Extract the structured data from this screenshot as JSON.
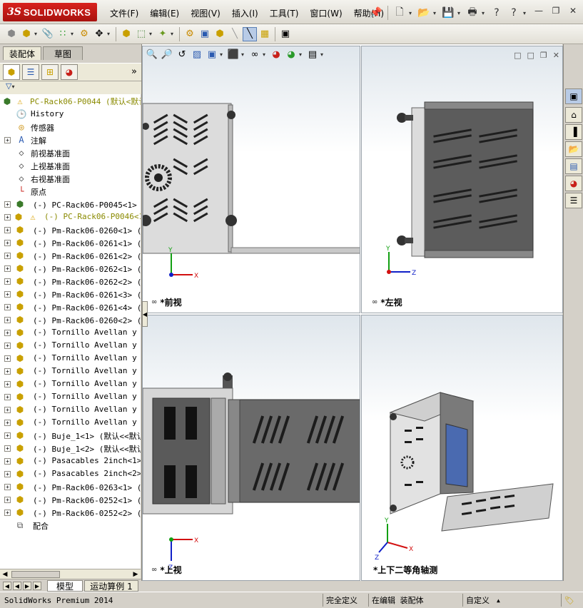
{
  "app": {
    "logo_ds": "3S",
    "logo_name": "SOLIDWORKS"
  },
  "menus": [
    "文件(F)",
    "编辑(E)",
    "视图(V)",
    "插入(I)",
    "工具(T)",
    "窗口(W)",
    "帮助(H)"
  ],
  "left_tabs": {
    "assembly": "装配体",
    "sketch": "草图"
  },
  "tree": {
    "root": "PC-Rack06-P0044 (默认<默认",
    "items": [
      {
        "label": "History",
        "icon": "history-icon",
        "expander": false
      },
      {
        "label": "传感器",
        "icon": "sensor-icon",
        "expander": false
      },
      {
        "label": "注解",
        "icon": "annotation-icon",
        "expander": true
      },
      {
        "label": "前视基准面",
        "icon": "plane-icon",
        "expander": false
      },
      {
        "label": "上视基准面",
        "icon": "plane-icon",
        "expander": false
      },
      {
        "label": "右视基准面",
        "icon": "plane-icon",
        "expander": false
      },
      {
        "label": "原点",
        "icon": "origin-icon",
        "expander": false
      },
      {
        "label": "(-) PC-Rack06-P0045<1> (默",
        "icon": "assembly-icon",
        "expander": true
      },
      {
        "label": "(-) PC-Rack06-P0046<1> (",
        "icon": "warning-icon",
        "expander": true,
        "suppressed": true
      },
      {
        "label": "(-) Pm-Rack06-0260<1> (默",
        "icon": "part-icon",
        "expander": true
      },
      {
        "label": "(-) Pm-Rack06-0261<1> (默",
        "icon": "part-icon",
        "expander": true
      },
      {
        "label": "(-) Pm-Rack06-0261<2> (默",
        "icon": "part-icon",
        "expander": true
      },
      {
        "label": "(-) Pm-Rack06-0262<1> (默",
        "icon": "part-icon",
        "expander": true
      },
      {
        "label": "(-) Pm-Rack06-0262<2> (默",
        "icon": "part-icon",
        "expander": true
      },
      {
        "label": "(-) Pm-Rack06-0261<3> (默",
        "icon": "part-icon",
        "expander": true
      },
      {
        "label": "(-) Pm-Rack06-0261<4> (默",
        "icon": "part-icon",
        "expander": true
      },
      {
        "label": "(-) Pm-Rack06-0260<2> (默",
        "icon": "part-icon",
        "expander": true
      },
      {
        "label": "(-) Tornillo Avellan y Tu",
        "icon": "part-icon",
        "expander": true
      },
      {
        "label": "(-) Tornillo Avellan y Tu",
        "icon": "part-icon",
        "expander": true
      },
      {
        "label": "(-) Tornillo Avellan y Tu",
        "icon": "part-icon",
        "expander": true
      },
      {
        "label": "(-) Tornillo Avellan y Tu",
        "icon": "part-icon",
        "expander": true
      },
      {
        "label": "(-) Tornillo Avellan y Tu",
        "icon": "part-icon",
        "expander": true
      },
      {
        "label": "(-) Tornillo Avellan y Tu",
        "icon": "part-icon",
        "expander": true
      },
      {
        "label": "(-) Tornillo Avellan y Tu",
        "icon": "part-icon",
        "expander": true
      },
      {
        "label": "(-) Tornillo Avellan y Tu",
        "icon": "part-icon",
        "expander": true
      },
      {
        "label": "(-) Buje_1<1> (默认<<默认>",
        "icon": "part-icon",
        "expander": true
      },
      {
        "label": "(-) Buje_1<2> (默认<<默认>",
        "icon": "part-icon",
        "expander": true
      },
      {
        "label": "(-) Pasacables 2inch<1> (",
        "icon": "part-icon",
        "expander": true
      },
      {
        "label": "(-) Pasacables 2inch<2> (",
        "icon": "part-icon",
        "expander": true
      },
      {
        "label": "(-) Pm-Rack06-0263<1> (默",
        "icon": "part-icon",
        "expander": true
      },
      {
        "label": "(-) Pm-Rack06-0252<1> (默",
        "icon": "part-icon",
        "expander": true
      },
      {
        "label": "(-) Pm-Rack06-0252<2> (默",
        "icon": "part-icon",
        "expander": true
      },
      {
        "label": "配合",
        "icon": "mates-icon",
        "expander": false
      }
    ]
  },
  "bottom_tabs": {
    "model": "模型",
    "motion": "运动算例 1"
  },
  "views": {
    "front": "*前视",
    "left": "*左视",
    "top": "*上视",
    "iso": "*上下二等角轴测"
  },
  "axes": {
    "x": "X",
    "y": "Y",
    "z": "Z"
  },
  "status": {
    "product": "SolidWorks Premium 2014",
    "defined": "完全定义",
    "editing": "在编辑 装配体",
    "custom": "自定义"
  },
  "colors": {
    "brand_red": "#c8201a",
    "sheet_metal": "#dcdcdc",
    "dark_metal": "#5a5a5a",
    "axis_x": "#d21010",
    "axis_y": "#12a012",
    "axis_z": "#1020c8"
  }
}
